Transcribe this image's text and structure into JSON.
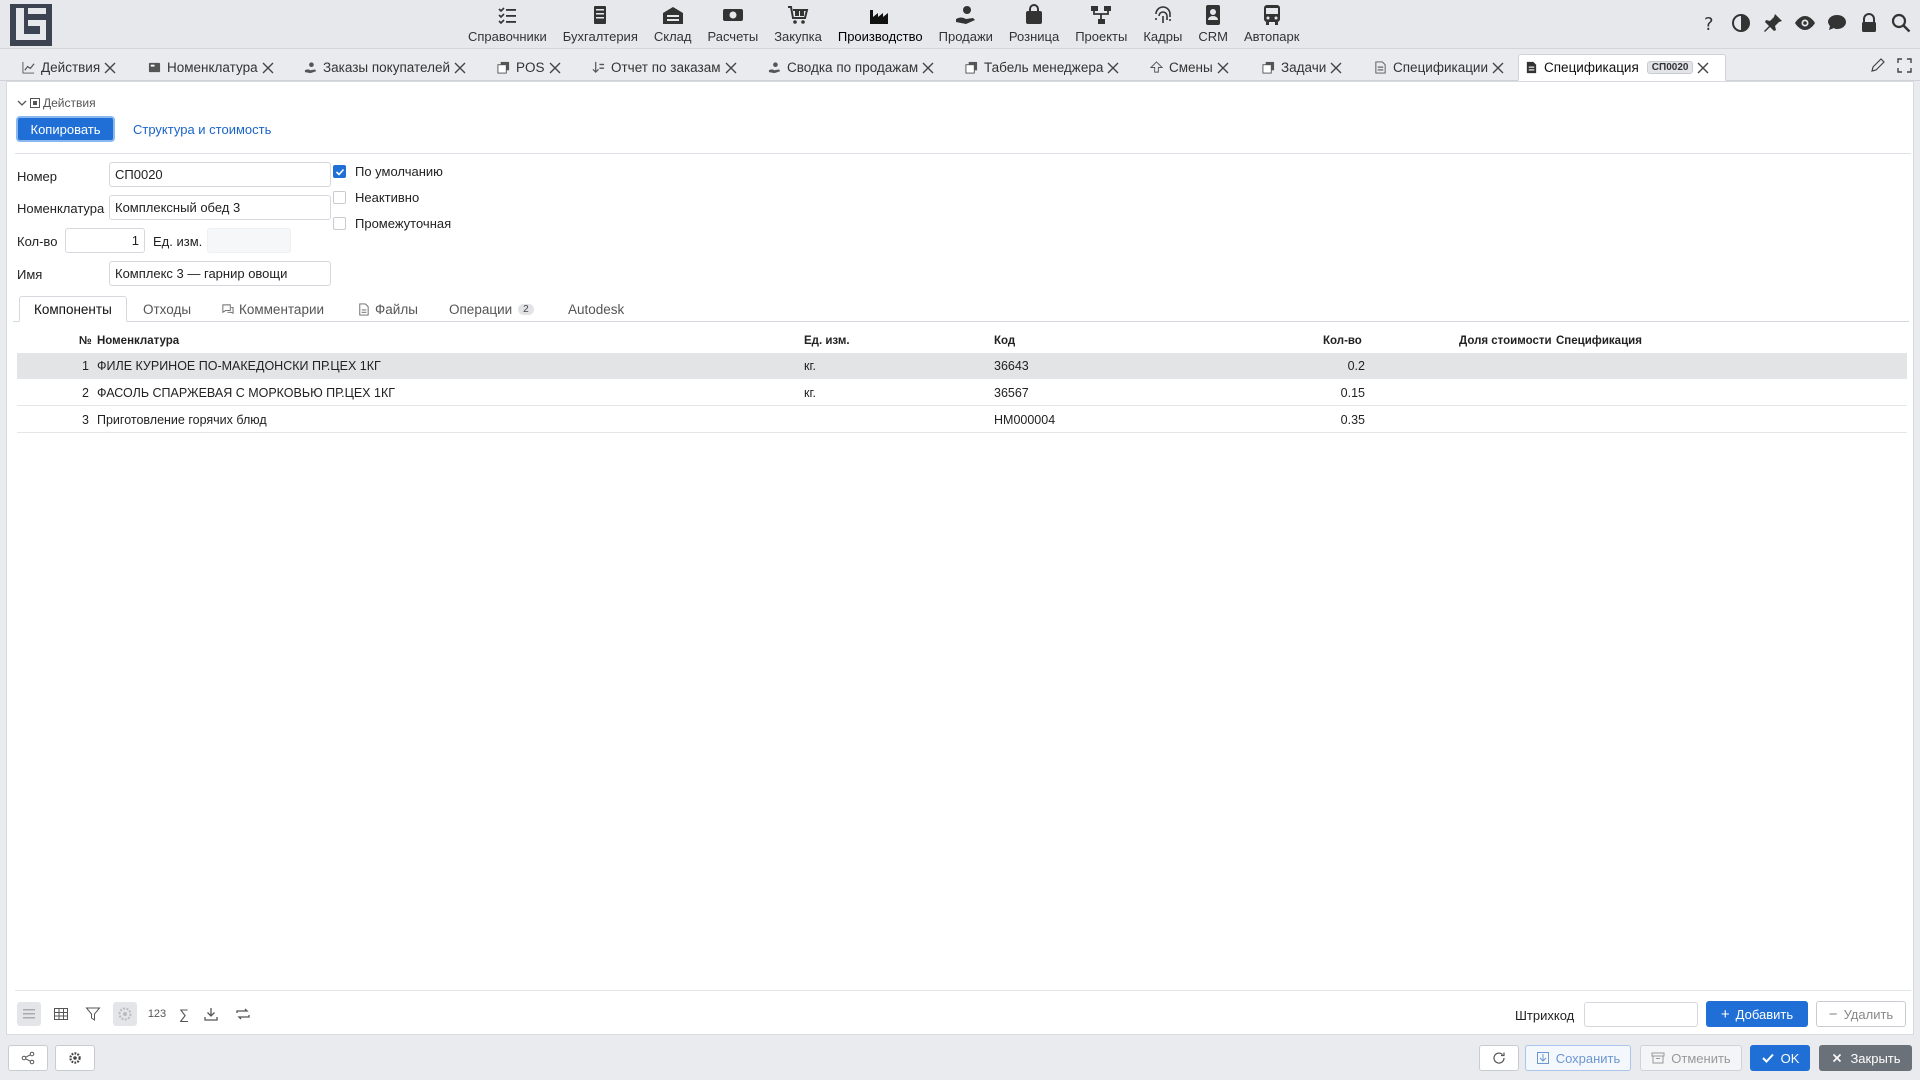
{
  "nav": {
    "items": [
      {
        "label": "Справочники",
        "icon": "checklist-icon"
      },
      {
        "label": "Бухгалтерия",
        "icon": "ledger-icon"
      },
      {
        "label": "Склад",
        "icon": "warehouse-icon"
      },
      {
        "label": "Расчеты",
        "icon": "cash-icon"
      },
      {
        "label": "Закупка",
        "icon": "cart-icon"
      },
      {
        "label": "Производство",
        "icon": "factory-icon"
      },
      {
        "label": "Продажи",
        "icon": "hand-coin-icon"
      },
      {
        "label": "Розница",
        "icon": "bag-icon"
      },
      {
        "label": "Проекты",
        "icon": "network-icon"
      },
      {
        "label": "Кадры",
        "icon": "fingerprint-icon"
      },
      {
        "label": "CRM",
        "icon": "contact-card-icon"
      },
      {
        "label": "Автопарк",
        "icon": "bus-icon"
      }
    ],
    "active": "Производство"
  },
  "tabs": [
    {
      "label": "Действия"
    },
    {
      "label": "Номенклатура"
    },
    {
      "label": "Заказы покупателей"
    },
    {
      "label": "POS"
    },
    {
      "label": "Отчет по заказам"
    },
    {
      "label": "Сводка по продажам"
    },
    {
      "label": "Табель менеджера"
    },
    {
      "label": "Смены"
    },
    {
      "label": "Задачи"
    },
    {
      "label": "Спецификации"
    },
    {
      "label": "Спецификация",
      "badge": "СП0020"
    }
  ],
  "actions": {
    "toggle_label": "Действия",
    "copy_label": "Копировать",
    "structure_label": "Структура и стоимость"
  },
  "form": {
    "number_label": "Номер",
    "number_value": "СП0020",
    "nomenclature_label": "Номенклатура",
    "nomenclature_value": "Комплексный обед 3",
    "qty_label": "Кол-во",
    "qty_value": "1",
    "unit_label": "Ед. изм.",
    "unit_value": "",
    "name_label": "Имя",
    "name_value": "Комплекс 3 — гарнир овощи",
    "default_label": "По умолчанию",
    "default_checked": true,
    "inactive_label": "Неактивно",
    "inactive_checked": false,
    "intermediate_label": "Промежуточная",
    "intermediate_checked": false
  },
  "section_tabs": [
    {
      "label": "Компоненты"
    },
    {
      "label": "Отходы"
    },
    {
      "label": "Комментарии"
    },
    {
      "label": "Файлы"
    },
    {
      "label": "Операции",
      "count": "2"
    },
    {
      "label": "Autodesk"
    }
  ],
  "table": {
    "columns": {
      "num": "№",
      "nomenclature": "Номенклатура",
      "unit": "Ед. изм.",
      "code": "Код",
      "qty": "Кол-во",
      "cost_share": "Доля стоимости",
      "spec": "Спецификация"
    },
    "rows": [
      {
        "num": "1",
        "nomenclature": "ФИЛЕ КУРИНОЕ ПО-МАКЕДОНСКИ ПР.ЦЕХ 1КГ",
        "unit": "кг.",
        "code": "36643",
        "qty": "0.2",
        "cost_share": "",
        "spec": ""
      },
      {
        "num": "2",
        "nomenclature": "ФАСОЛЬ СПАРЖЕВАЯ С МОРКОВЬЮ ПР.ЦЕХ 1КГ",
        "unit": "кг.",
        "code": "36567",
        "qty": "0.15",
        "cost_share": "",
        "spec": ""
      },
      {
        "num": "3",
        "nomenclature": "Приготовление горячих блюд",
        "unit": "",
        "code": "НМ000004",
        "qty": "0.35",
        "cost_share": "",
        "spec": ""
      }
    ]
  },
  "toolbar": {
    "count_label": "123",
    "sum_label": "∑",
    "barcode_label": "Штрихкод",
    "add_label": "Добавить",
    "delete_label": "Удалить"
  },
  "footer": {
    "save_label": "Сохранить",
    "cancel_label": "Отменить",
    "ok_label": "OK",
    "close_label": "Закрыть"
  },
  "colors": {
    "accent": "#1f6fd6",
    "selected_row": "#e3e4e5",
    "close_button": "#6b7178"
  }
}
